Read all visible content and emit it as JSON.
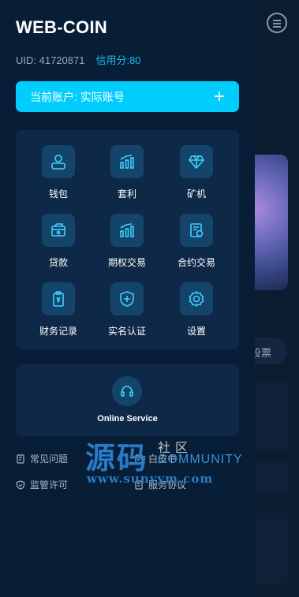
{
  "app": {
    "title": "WEB-COIN"
  },
  "user": {
    "uid": "UID: 41720871",
    "credit": "信用分:80"
  },
  "account": {
    "label": "当前账户: 实际账号",
    "plus": "+"
  },
  "grid": [
    {
      "label": "钱包",
      "icon": "wallet-user-icon"
    },
    {
      "label": "套利",
      "icon": "bar-chart-icon"
    },
    {
      "label": "矿机",
      "icon": "diamond-icon"
    },
    {
      "label": "贷款",
      "icon": "loan-card-icon"
    },
    {
      "label": "期权交易",
      "icon": "options-chart-icon"
    },
    {
      "label": "合约交易",
      "icon": "contract-document-icon"
    },
    {
      "label": "财务记录",
      "icon": "finance-record-icon"
    },
    {
      "label": "实名认证",
      "icon": "shield-plus-icon"
    },
    {
      "label": "设置",
      "icon": "settings-gear-icon"
    }
  ],
  "service": {
    "label": "Online Service",
    "icon": "headset-icon"
  },
  "footer": {
    "faq": "常见问题",
    "white_paper": "白皮书",
    "license": "监管许可",
    "agreement": "服务协议"
  },
  "background": {
    "pill_text": "股票"
  },
  "watermark": {
    "big": "源码",
    "small": "社区",
    "community": "COMMUNITY",
    "url": "www.sunyym.com"
  },
  "colors": {
    "accent": "#00cdfc",
    "credit": "#21b8f0",
    "panel": "#0e2947",
    "drawer": "#071e36"
  }
}
